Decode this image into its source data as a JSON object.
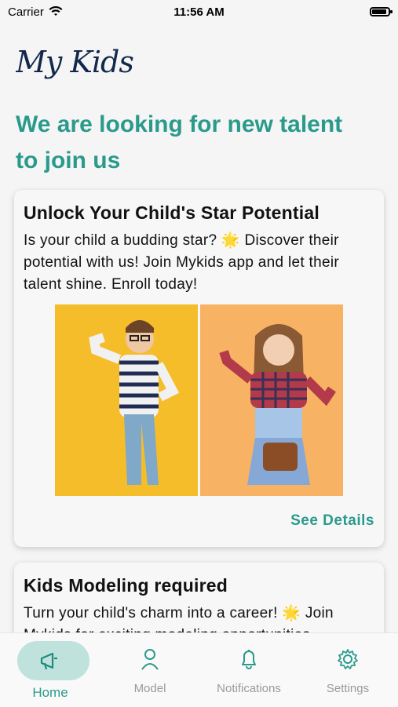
{
  "status_bar": {
    "carrier": "Carrier",
    "time": "11:56 AM"
  },
  "logo": {
    "text": "My Kids"
  },
  "headline": "We are looking for new talent to join us",
  "cards": [
    {
      "title": "Unlock Your Child's Star Potential",
      "text": "Is your child a budding star? 🌟  Discover their potential with us! Join Mykids app  and let their talent shine. Enroll today!",
      "link": "See Details"
    },
    {
      "title": "Kids Modeling required",
      "text": "Turn your child's charm into a career! 🌟  Join Mykids for exciting modeling opportunities"
    }
  ],
  "tabs": [
    {
      "label": "Home",
      "icon": "megaphone-icon",
      "active": true
    },
    {
      "label": "Model",
      "icon": "person-icon",
      "active": false
    },
    {
      "label": "Notifications",
      "icon": "bell-icon",
      "active": false
    },
    {
      "label": "Settings",
      "icon": "gear-icon",
      "active": false
    }
  ],
  "colors": {
    "accent": "#2a9a8c",
    "active_pill": "#bfe3dc",
    "logo": "#13294b"
  }
}
